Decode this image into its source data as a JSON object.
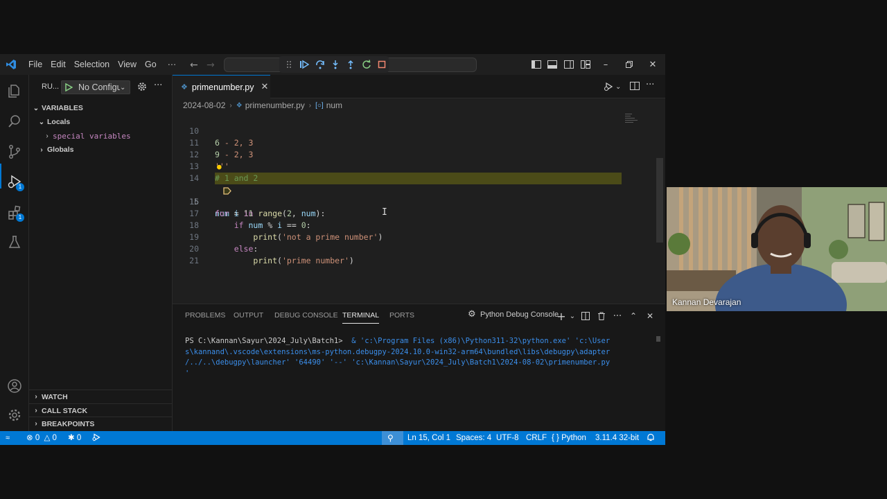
{
  "menu": [
    "File",
    "Edit",
    "Selection",
    "View",
    "Go",
    "···"
  ],
  "sidebar": {
    "title": "RU...",
    "config": "No Configu",
    "sections": {
      "variables": "VARIABLES",
      "locals": "Locals",
      "special": "special variables",
      "globals": "Globals",
      "watch": "WATCH",
      "callstack": "CALL STACK",
      "breakpoints": "BREAKPOINTS"
    }
  },
  "activity_badges": {
    "run": "1",
    "extensions": "1"
  },
  "tab": {
    "filename": "primenumber.py"
  },
  "breadcrumb": {
    "folder": "2024-08-02",
    "file": "primenumber.py",
    "symbol": "num"
  },
  "code": {
    "line_numbers": [
      "10",
      "11",
      "12",
      "13",
      "14",
      "15",
      "16",
      "17",
      "18",
      "19",
      "20",
      "21"
    ],
    "current_line": "15"
  },
  "panel": {
    "tabs": [
      "PROBLEMS",
      "OUTPUT",
      "DEBUG CONSOLE",
      "TERMINAL",
      "PORTS"
    ],
    "active_tab": "TERMINAL",
    "terminal_name": "Python Debug Console",
    "prompt": "PS C:\\Kannan\\Sayur\\2024_July\\Batch1> ",
    "command_l1": " & 'c:\\Program Files (x86)\\Python311-32\\python.exe' 'c:\\User",
    "command_l2": "s\\kannand\\.vscode\\extensions\\ms-python.debugpy-2024.10.0-win32-arm64\\bundled\\libs\\debugpy\\adapter",
    "command_l3": "/../..\\debugpy\\launcher' '64490' '--' 'c:\\Kannan\\Sayur\\2024_July\\Batch1\\2024-08-02\\primenumber.py",
    "command_l4": "'"
  },
  "status": {
    "errors": "0",
    "warnings": "0",
    "ports": "0",
    "position": "Ln 15, Col 1",
    "spaces": "Spaces: 4",
    "encoding": "UTF-8",
    "eol": "CRLF",
    "language": "Python",
    "interpreter": "3.11.4 32-bit"
  },
  "webcam": {
    "name": "Kannan Devarajan"
  },
  "colors": {
    "accent": "#0078d4",
    "editor_bg": "#1f1f1f",
    "sidebar_bg": "#181818",
    "debug_line": "#4b4b18",
    "breakpoint": "#e5c07b"
  }
}
